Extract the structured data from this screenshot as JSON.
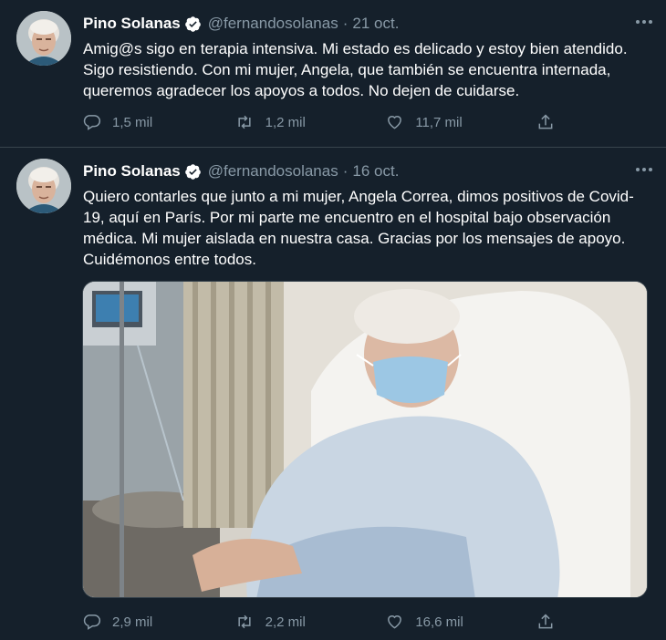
{
  "tweets": [
    {
      "author": "Pino Solanas",
      "handle": "@fernandosolanas",
      "date": "21 oct.",
      "text": "Amig@s sigo en terapia intensiva. Mi estado es delicado y estoy bien atendido. Sigo resistiendo. Con mi mujer, Angela, que también se encuentra internada, queremos agradecer los apoyos a todos. No dejen de cuidarse.",
      "replies": "1,5 mil",
      "retweets": "1,2 mil",
      "likes": "11,7 mil"
    },
    {
      "author": "Pino Solanas",
      "handle": "@fernandosolanas",
      "date": "16 oct.",
      "text": "Quiero contarles que junto a mi mujer, Angela Correa, dimos positivos de Covid-19, aquí en París. Por mi parte me encuentro en el hospital bajo observación médica. Mi mujer aislada en nuestra casa. Gracias por los mensajes de apoyo. Cuidémonos entre todos.",
      "replies": "2,9 mil",
      "retweets": "2,2 mil",
      "likes": "16,6 mil"
    }
  ],
  "separator": "·",
  "colors": {
    "background": "#15202b",
    "border": "#38444d",
    "secondary_text": "#8899a6",
    "verified": "#ffffff"
  },
  "icons": [
    "verified-badge-icon",
    "more-icon",
    "reply-icon",
    "retweet-icon",
    "like-icon",
    "share-icon"
  ]
}
